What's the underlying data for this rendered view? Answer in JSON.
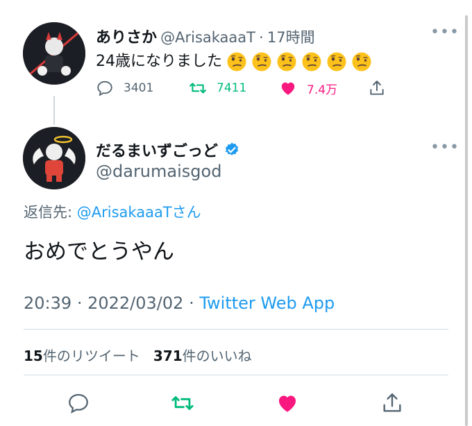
{
  "tweet1": {
    "name": "ありさか",
    "handle": "@ArisakaaaT",
    "sep": "·",
    "time": "17時間",
    "text": "24歳になりました",
    "emoji_count": 6,
    "emoji_icon": "face-with-uneven-eyes",
    "replies": "3401",
    "retweets": "7411",
    "likes": "7.4万"
  },
  "tweet2": {
    "name": "だるまいずごっど",
    "verified_icon": "verified-badge",
    "handle": "@darumaisgod",
    "reply_prefix": "返信先:",
    "reply_target": "@ArisakaaaTさん",
    "text": "おめでとうやん",
    "time": "20:39",
    "sep": "·",
    "date": "2022/03/02",
    "client": "Twitter Web App",
    "retweet_count": "15",
    "retweet_label": "件のリツイート",
    "like_count": "371",
    "like_label": "件のいいね"
  },
  "colors": {
    "blue": "#1d9bf0",
    "green": "#00ba7c",
    "pink": "#f91880",
    "gray": "#536471"
  }
}
